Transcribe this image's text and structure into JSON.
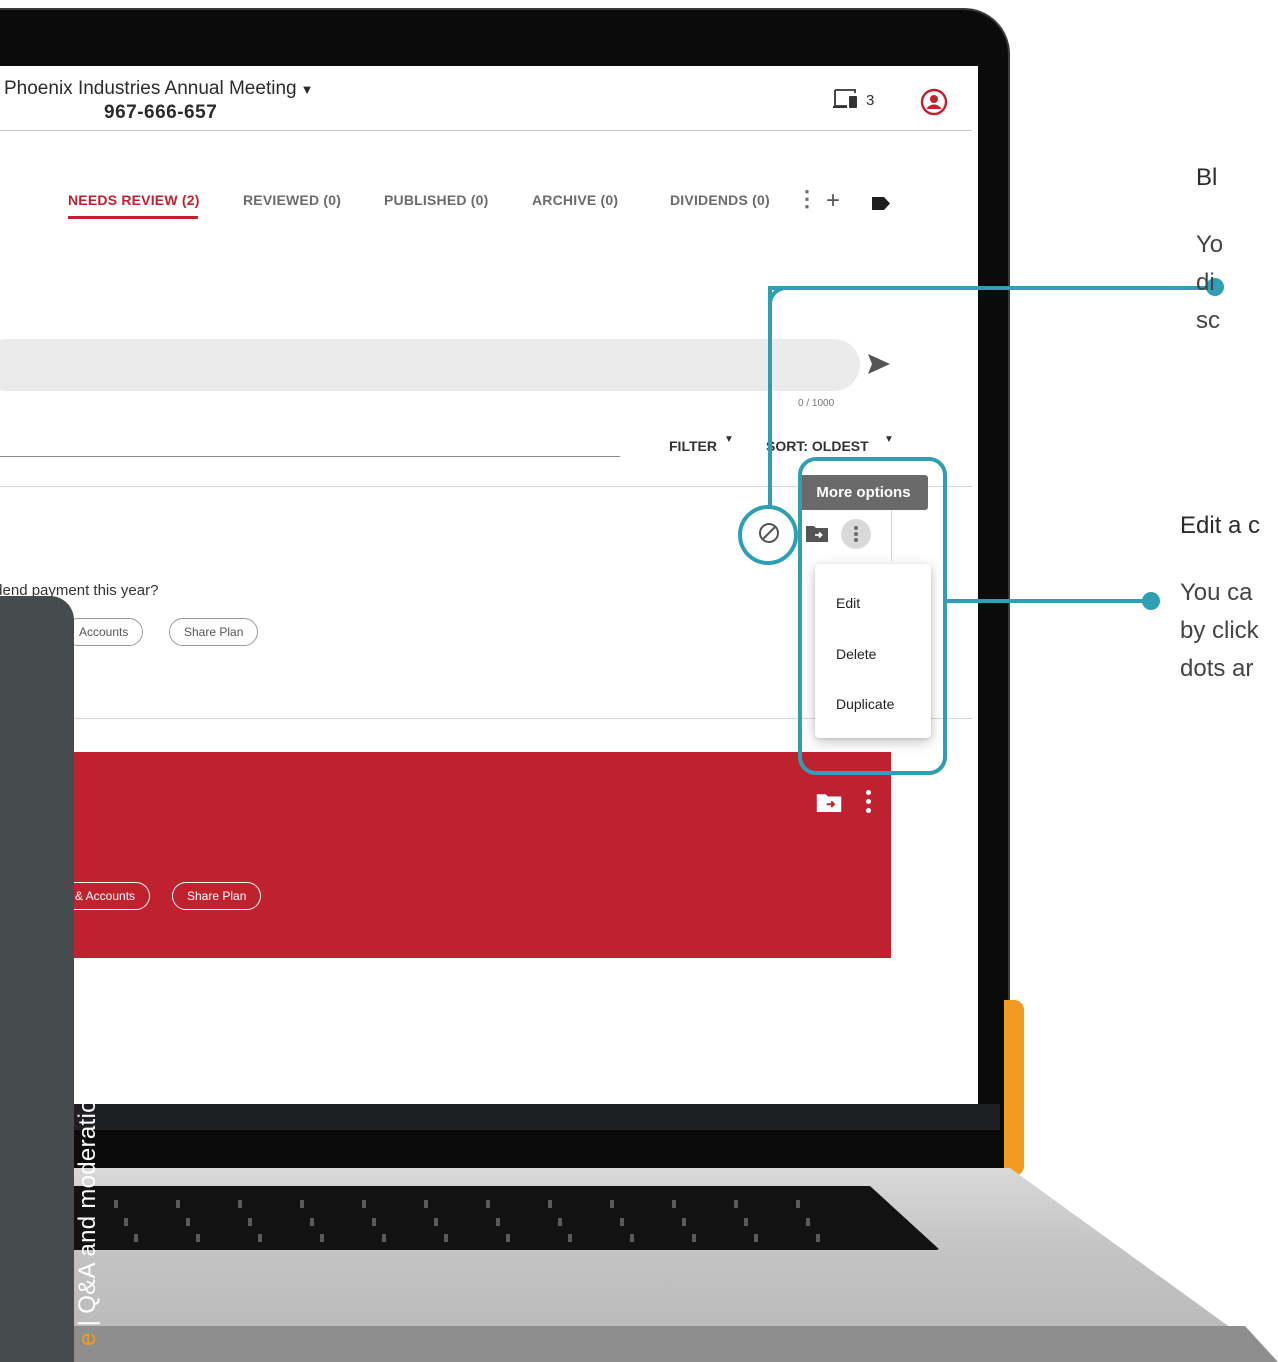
{
  "header": {
    "meeting_title": "Phoenix Industries Annual Meeting",
    "meeting_id": "967-666-657",
    "device_count": "3"
  },
  "tabs": [
    {
      "label": "NEEDS REVIEW (2)",
      "active": true
    },
    {
      "label": "REVIEWED (0)"
    },
    {
      "label": "PUBLISHED (0)"
    },
    {
      "label": "ARCHIVE (0)"
    },
    {
      "label": "DIVIDENDS (0)"
    }
  ],
  "composer": {
    "placeholder": "",
    "char_count": "0 / 1000"
  },
  "toolbar": {
    "filter_label": "FILTER",
    "sort_label": "SORT: OLDEST"
  },
  "questions": [
    {
      "text": "ividend payment this year?",
      "tags": [
        "Accounts",
        "Share Plan"
      ]
    },
    {
      "text": "",
      "tags": [
        "& Accounts",
        "Share Plan"
      ]
    }
  ],
  "more_options": {
    "tooltip": "More options",
    "items": [
      "Edit",
      "Delete",
      "Duplicate"
    ]
  },
  "callouts": {
    "block": {
      "title": "Bl",
      "lines": [
        "Yo",
        "di",
        "sc"
      ]
    },
    "edit": {
      "title": "Edit a c",
      "lines": [
        "You ca",
        "by click",
        "dots ar"
      ]
    }
  },
  "side_panel": {
    "label": "Q&A and moderation",
    "separator": "|",
    "accent_fragment": "e"
  },
  "colors": {
    "accent_red": "#c0212f",
    "highlight_teal": "#2e9fb5",
    "laptop_orange": "#f39b1e",
    "side_panel": "#464c4e"
  }
}
